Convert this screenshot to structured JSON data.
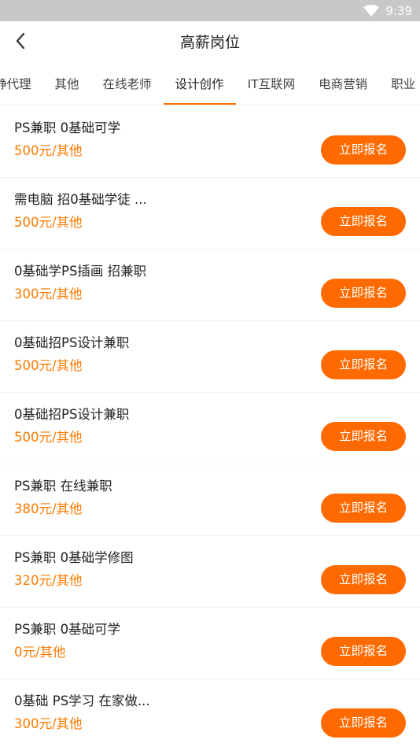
{
  "status_bar": {
    "time": "9:39"
  },
  "header": {
    "title": "高薪岗位"
  },
  "tabs": [
    {
      "label": "静代理",
      "active": false
    },
    {
      "label": "其他",
      "active": false
    },
    {
      "label": "在线老师",
      "active": false
    },
    {
      "label": "设计创作",
      "active": true
    },
    {
      "label": "IT互联网",
      "active": false
    },
    {
      "label": "电商营销",
      "active": false
    },
    {
      "label": "职业",
      "active": false
    }
  ],
  "jobs": [
    {
      "title": "PS兼职 0基础可学",
      "salary": "500元/其他",
      "button": "立即报名"
    },
    {
      "title": "需电脑 招0基础学徒 ...",
      "salary": "500元/其他",
      "button": "立即报名"
    },
    {
      "title": "0基础学PS插画 招兼职",
      "salary": "300元/其他",
      "button": "立即报名"
    },
    {
      "title": "0基础招PS设计兼职",
      "salary": "500元/其他",
      "button": "立即报名"
    },
    {
      "title": "0基础招PS设计兼职",
      "salary": "500元/其他",
      "button": "立即报名"
    },
    {
      "title": "PS兼职 在线兼职",
      "salary": "380元/其他",
      "button": "立即报名"
    },
    {
      "title": "PS兼职 0基础学修图",
      "salary": "320元/其他",
      "button": "立即报名"
    },
    {
      "title": "PS兼职 0基础可学",
      "salary": "0元/其他",
      "button": "立即报名"
    },
    {
      "title": "0基础 PS学习 在家做...",
      "salary": "300元/其他",
      "button": "立即报名"
    }
  ],
  "colors": {
    "accent": "#ff6a00",
    "salary": "#ff7a00",
    "status_bar": "#c8c8c8"
  },
  "icons": {
    "back": "back-arrow-icon",
    "wifi": "wifi-icon"
  }
}
